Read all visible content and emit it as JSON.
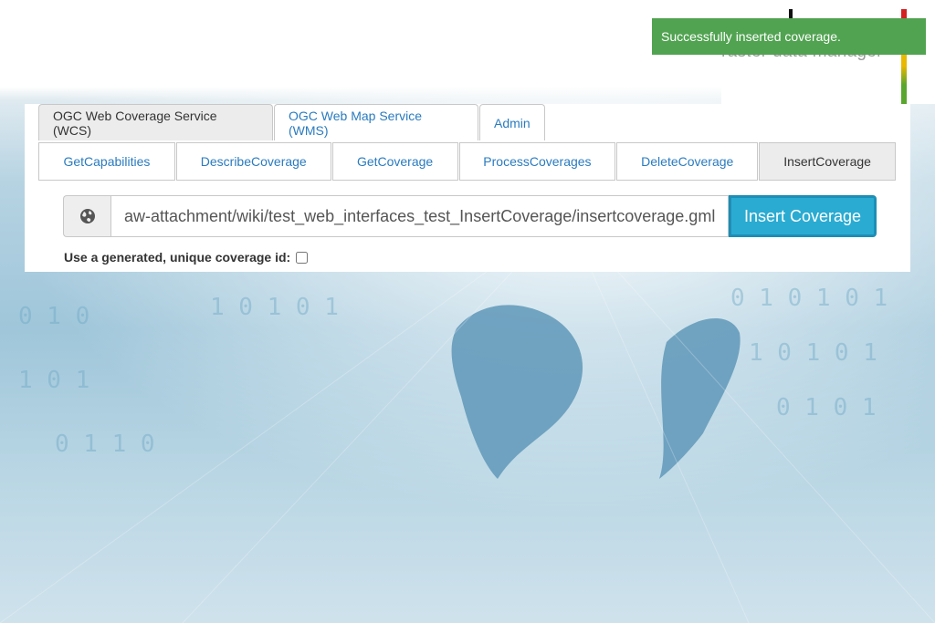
{
  "logo": {
    "tagline": "raster data manager"
  },
  "toast": {
    "message": "Successfully inserted coverage.",
    "color": "#51a351"
  },
  "main_tabs": [
    {
      "label": "OGC Web Coverage Service (WCS)",
      "active": true
    },
    {
      "label": "OGC Web Map Service (WMS)",
      "active": false
    },
    {
      "label": "Admin",
      "active": false
    }
  ],
  "sub_tabs": [
    {
      "label": "GetCapabilities",
      "active": false
    },
    {
      "label": "DescribeCoverage",
      "active": false
    },
    {
      "label": "GetCoverage",
      "active": false
    },
    {
      "label": "ProcessCoverages",
      "active": false
    },
    {
      "label": "DeleteCoverage",
      "active": false
    },
    {
      "label": "InsertCoverage",
      "active": true
    }
  ],
  "insert_form": {
    "url_value": "aw-attachment/wiki/test_web_interfaces_test_InsertCoverage/insertcoverage.gml",
    "addon_icon": "globe-icon",
    "button_label": "Insert Coverage",
    "button_color": "#2aabd2",
    "checkbox_label": "Use a generated, unique coverage id:",
    "checkbox_checked": false
  }
}
